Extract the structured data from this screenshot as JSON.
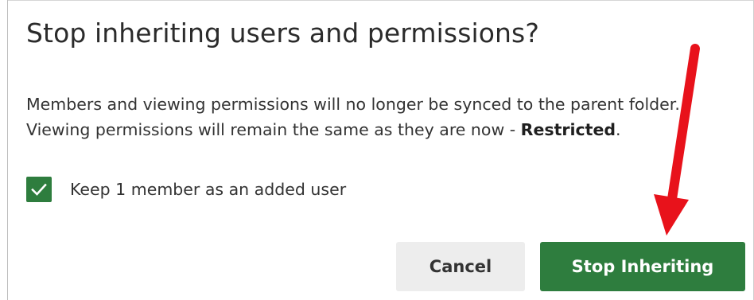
{
  "dialog": {
    "title": "Stop inheriting users and permissions?",
    "description": {
      "line1": "Members and viewing permissions will no longer be synced to the parent folder.",
      "line2_prefix": "Viewing permissions will remain the same as they are now - ",
      "line2_emphasis": "Restricted",
      "line2_suffix": "."
    },
    "checkbox": {
      "label": "Keep 1 member as an added user",
      "checked": true
    },
    "buttons": {
      "cancel_label": "Cancel",
      "confirm_label": "Stop Inheriting"
    }
  },
  "colors": {
    "accent_green": "#2e7d3e",
    "cancel_button_bg": "#ededed",
    "annotation_arrow": "#e8121b"
  },
  "annotation": {
    "icon": "red-arrow-icon",
    "points_to": "confirm-button"
  }
}
